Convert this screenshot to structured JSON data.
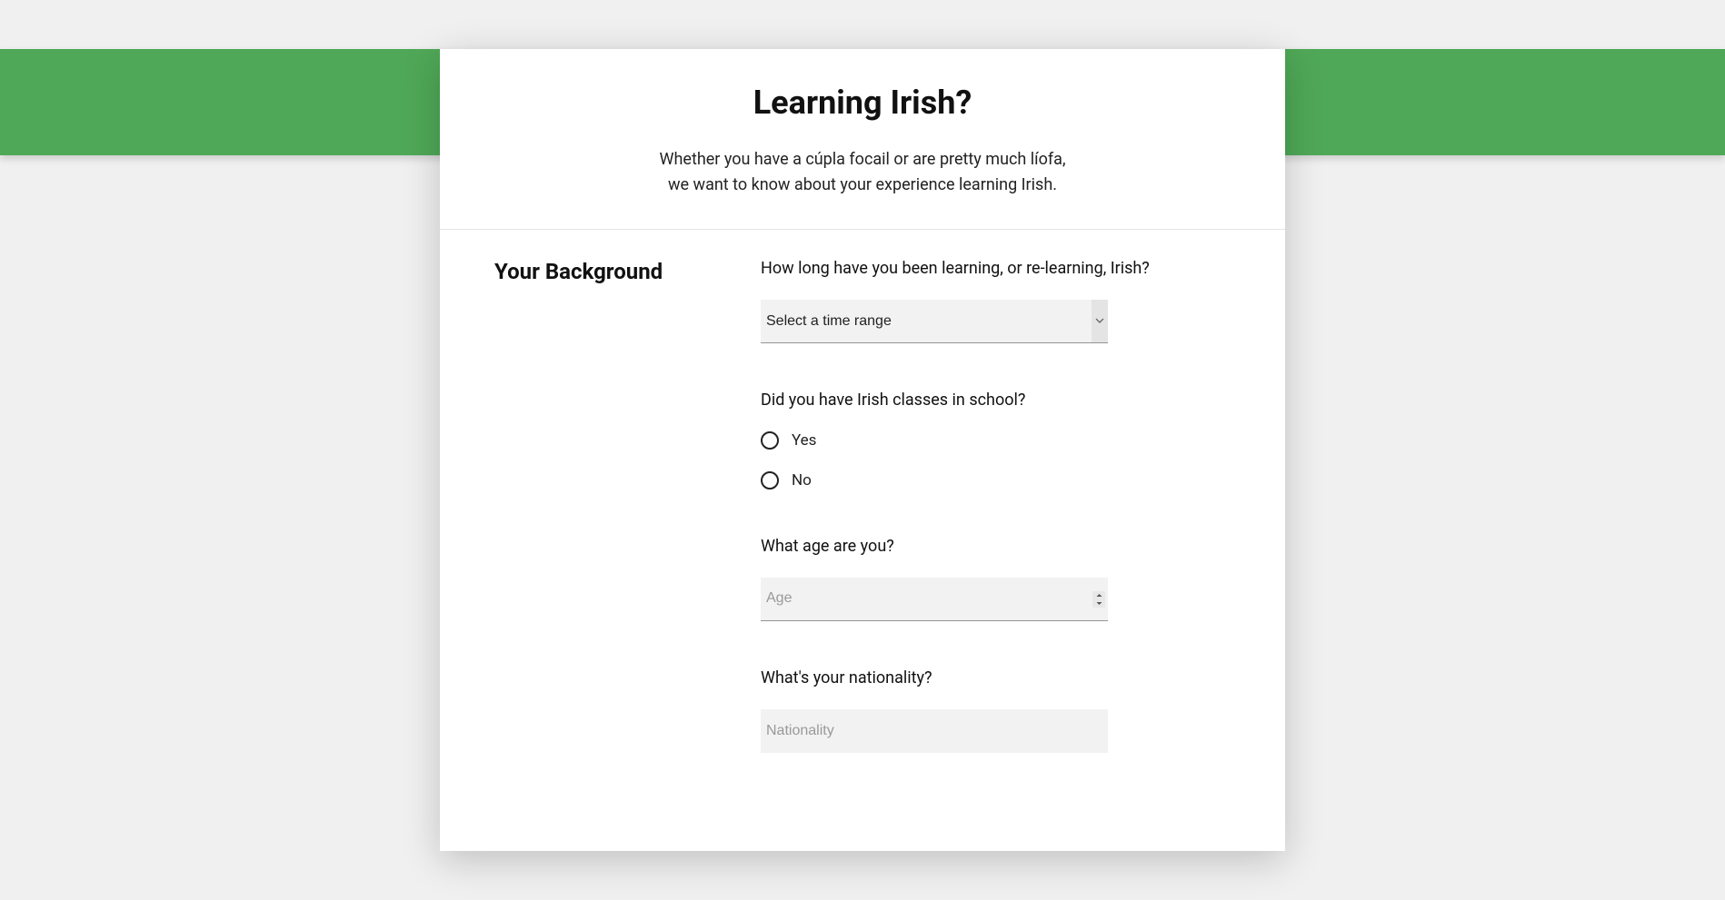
{
  "header": {
    "title": "Learning Irish?",
    "subtitle_line1": "Whether you have a cúpla focail or are pretty much líofa,",
    "subtitle_line2": "we want to know about your experience learning Irish."
  },
  "section": {
    "label": "Your Background"
  },
  "questions": {
    "duration": {
      "label": "How long have you been learning, or re-learning, Irish?",
      "selected": "Select a time range"
    },
    "school": {
      "label": "Did you have Irish classes in school?",
      "options": [
        "Yes",
        "No"
      ]
    },
    "age": {
      "label": "What age are you?",
      "placeholder": "Age"
    },
    "nationality": {
      "label": "What's your nationality?",
      "placeholder": "Nationality"
    }
  }
}
